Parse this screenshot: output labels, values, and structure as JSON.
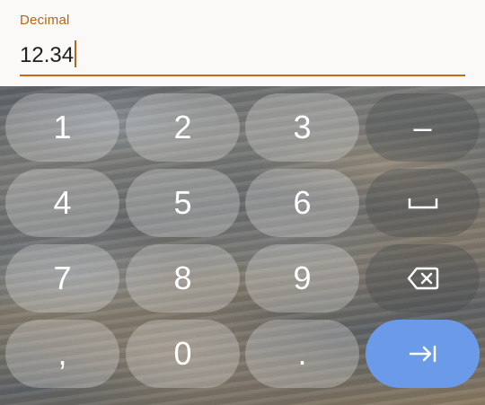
{
  "field": {
    "label": "Decimal",
    "value": "12.34",
    "accent_color": "#c56b18"
  },
  "keyboard": {
    "rows": [
      [
        "1",
        "2",
        "3",
        "–"
      ],
      [
        "4",
        "5",
        "6",
        "space-icon"
      ],
      [
        "7",
        "8",
        "9",
        "backspace-icon"
      ],
      [
        ",",
        "0",
        ".",
        "tab-icon"
      ]
    ],
    "enter_color": "#6b9be8"
  }
}
